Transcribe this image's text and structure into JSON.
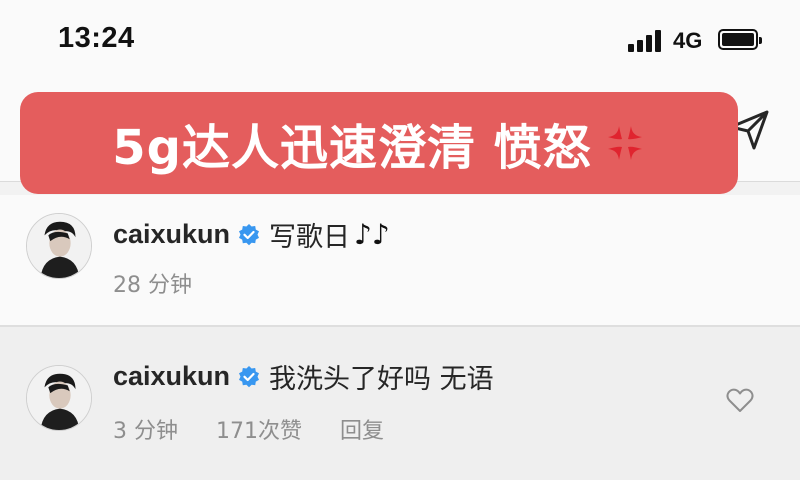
{
  "status_bar": {
    "time": "13:24",
    "network": "4G"
  },
  "banner": {
    "text": "5g达人迅速澄清 愤怒"
  },
  "comments": [
    {
      "username": "caixukun",
      "text": "写歌日",
      "time": "28 分钟"
    },
    {
      "username": "caixukun",
      "text": "我洗头了好吗 无语",
      "time": "3 分钟",
      "likes": "171次赞",
      "reply": "回复"
    }
  ],
  "colors": {
    "banner": "#e45d5d",
    "verified": "#3897f0",
    "meta": "#8e8e8e"
  },
  "icons": [
    "back-icon",
    "share-icon",
    "anger-icon",
    "verified-icon",
    "music-note-icon",
    "heart-icon"
  ]
}
